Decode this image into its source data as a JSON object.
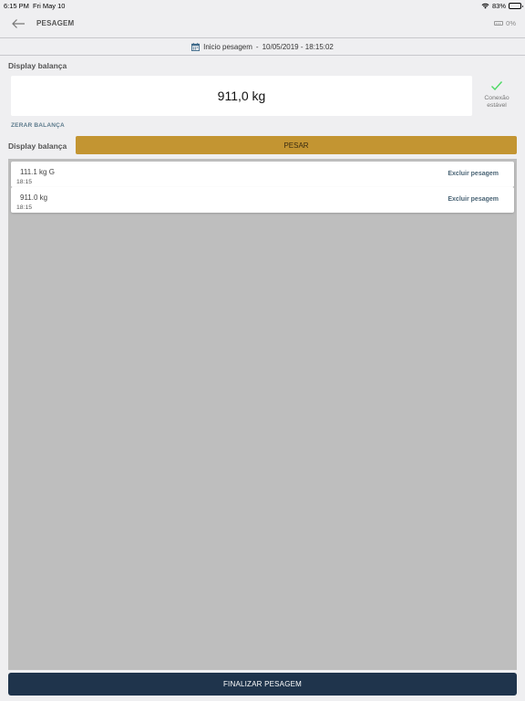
{
  "status_bar": {
    "time": "6:15 PM",
    "date": "Fri May 10",
    "battery_text": "83%",
    "battery_level": 0.83
  },
  "header": {
    "title": "PESAGEM",
    "scale_battery": "0%",
    "back_icon": "arrow-left-icon"
  },
  "session": {
    "start_label": "Inicio pesagem",
    "start_separator": "-",
    "start_value": "10/05/2019 - 18:15:02",
    "calendar_icon": "calendar-icon"
  },
  "display": {
    "label": "Display balança",
    "value": "911,0 kg",
    "connection_status": "Conexão estável",
    "connection_color": "#4cd964"
  },
  "actions": {
    "zero_scale": "ZERAR BALANÇA",
    "weigh_label": "Display balança",
    "weigh_button": "PESAR",
    "weigh_color": "#c39532",
    "finish_button": "FINALIZAR PESAGEM",
    "finish_color": "#1f344c"
  },
  "weighings": [
    {
      "weight": "111.1 kg G",
      "time": "18:15",
      "delete_label": "Excluir pesagem"
    },
    {
      "weight": "911.0 kg",
      "time": "18:15",
      "delete_label": "Excluir pesagem"
    }
  ]
}
